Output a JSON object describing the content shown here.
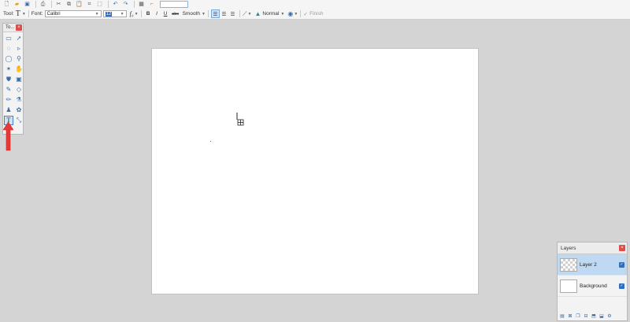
{
  "toolbar": {
    "tool_label": "Tool:",
    "font_label": "Font:",
    "font_value": "Calibri",
    "font_size_value": "12",
    "bold_label": "B",
    "italic_label": "I",
    "underline_label": "U",
    "strike_label": "abc",
    "antialias_value": "Smooth",
    "blend_mode_value": "Normal",
    "finish_label": "Finish",
    "icons": [
      "new-icon",
      "open-icon",
      "save-icon",
      "print-icon",
      "cut-icon",
      "copy-icon",
      "paste-icon",
      "crop-icon",
      "deselect-icon",
      "undo-icon",
      "redo-icon",
      "grid-icon",
      "ruler-icon"
    ]
  },
  "tools_panel": {
    "title": "To...",
    "close_label": "×",
    "tools": [
      {
        "name": "rectangle-select",
        "glyph": "▭"
      },
      {
        "name": "move-selected",
        "glyph": "➚"
      },
      {
        "name": "lasso-select",
        "glyph": "◌"
      },
      {
        "name": "move-selection",
        "glyph": "▹"
      },
      {
        "name": "ellipse-select",
        "glyph": "◯"
      },
      {
        "name": "zoom",
        "glyph": "⚲"
      },
      {
        "name": "magic-wand",
        "glyph": "✶"
      },
      {
        "name": "pan",
        "glyph": "✋"
      },
      {
        "name": "paint-bucket",
        "glyph": "⛊"
      },
      {
        "name": "gradient",
        "glyph": "▣"
      },
      {
        "name": "paintbrush",
        "glyph": "✎"
      },
      {
        "name": "eraser",
        "glyph": "◇"
      },
      {
        "name": "pencil",
        "glyph": "✏"
      },
      {
        "name": "color-picker",
        "glyph": "⚗"
      },
      {
        "name": "clone-stamp",
        "glyph": "♟"
      },
      {
        "name": "recolor",
        "glyph": "✿"
      },
      {
        "name": "text",
        "glyph": "T",
        "selected": true
      },
      {
        "name": "line-curve",
        "glyph": "⤡"
      }
    ]
  },
  "layers_panel": {
    "title": "Layers",
    "close_label": "×",
    "layers": [
      {
        "name": "Layer 2",
        "selected": true,
        "transparent": true
      },
      {
        "name": "Background",
        "selected": false,
        "transparent": false
      }
    ]
  },
  "colors": {
    "accent": "#2f6fc0",
    "close": "#e04b4b",
    "annotation_arrow": "#e53935"
  }
}
